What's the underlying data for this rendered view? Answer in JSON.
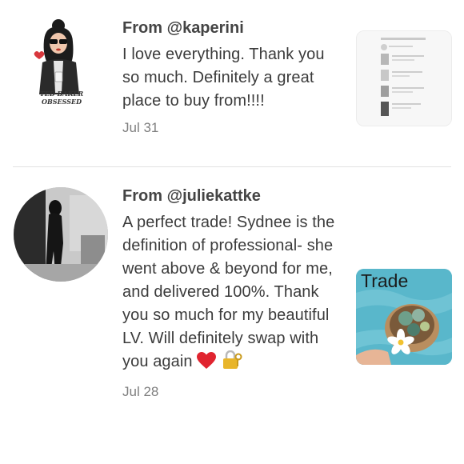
{
  "reviews": [
    {
      "from_prefix": "From ",
      "username": "@kaperini",
      "text": "I love everything. Thank you so much. Definitely a great place to buy from!!!!",
      "date": "Jul 31",
      "avatar_caption": [
        "TED BAKER",
        "OBSESSED"
      ],
      "thumb_icon": "listing-screenshot-icon"
    },
    {
      "from_prefix": "From ",
      "username": "@juliekattke",
      "text": "A perfect trade! Sydnee is the definition of professional- she went above & beyond for me, and delivered 100%. Thank you so much for my beautiful LV. Will definitely swap with you again",
      "emojis": [
        "red-heart-icon",
        "padlock-key-icon"
      ],
      "date": "Jul 28",
      "thumb_label": "Trade"
    }
  ],
  "colors": {
    "text": "#3b3b3b",
    "date": "#7f7f7f",
    "divider": "#e2e2e2"
  }
}
